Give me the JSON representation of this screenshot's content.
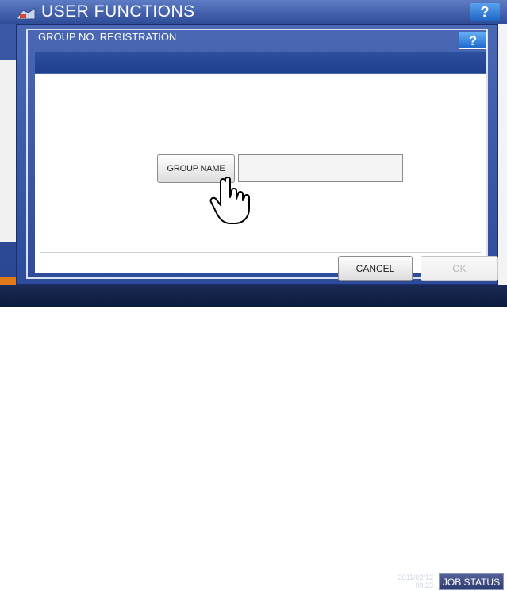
{
  "background": {
    "title": "USER FUNCTIONS",
    "help_label": "?",
    "date_line": "2011/02/12",
    "time_line": "09:23",
    "job_status_label": "JOB STATUS"
  },
  "dialog": {
    "title": "GROUP NO. REGISTRATION",
    "help_label": "?",
    "group_name_label": "GROUP NAME",
    "group_name_value": "",
    "cancel_label": "CANCEL",
    "ok_label": "OK"
  },
  "colors": {
    "header_blue": "#2f4c98",
    "help_blue": "#1f66c6",
    "accent_orange": "#e07a1a",
    "disabled_text": "#b8b8b8"
  },
  "icons": [
    "user-functions-icon",
    "help-icon",
    "pointer-hand-icon"
  ]
}
